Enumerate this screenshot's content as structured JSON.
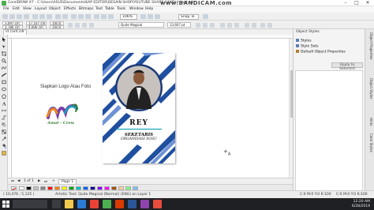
{
  "window": {
    "title": "CorelDRAW X7 - C:\\Users\\ASUS\\Documents\\KAP EDITOR\\DESAIN SHOP\\YOUTUBE SHARE SAKE\\id card.cdr",
    "watermark": "www.BANDICAM.com",
    "controls": [
      "–",
      "□",
      "✕"
    ]
  },
  "menu": [
    "File",
    "Edit",
    "View",
    "Layout",
    "Object",
    "Effects",
    "Bitmaps",
    "Text",
    "Table",
    "Tools",
    "Window",
    "Help"
  ],
  "toolbar": {
    "zoom_value": "106%",
    "snap_label": "Snap To"
  },
  "propbar": {
    "x": "3,097 cm",
    "y": "3,786 cm",
    "w": "17,107 cm",
    "h": "4,006 cm",
    "scale_w": "100,0",
    "scale_h": "100,0",
    "font_name": "Quite Magical",
    "font_size": "13,607 pt"
  },
  "document": {
    "tab_label": "id card.cdr"
  },
  "canvas": {
    "instruction": "Siapkan Logo Atau Foto",
    "logo_text": "Amal - Crew",
    "card_name": "REY",
    "card_line1": "SEKETARIS",
    "card_line2": "ORGANISASI SOSU"
  },
  "dock": {
    "title": "Object Styles",
    "items": [
      {
        "label": "Styles",
        "kind": "folder"
      },
      {
        "label": "Style Sets",
        "kind": "folder"
      },
      {
        "label": "Default Object Properties",
        "kind": "doc"
      }
    ],
    "apply_button": "Apply to Selected"
  },
  "sidetabs": [
    "Object Properties",
    "Object Styles",
    "Hints",
    "Color Styles"
  ],
  "pagenav": {
    "position": "1 of 1",
    "page_label": "Page 1"
  },
  "palette": [
    "#ffffff",
    "#000000",
    "#c0c0c0",
    "#808080",
    "#ff0000",
    "#ff8000",
    "#ffff00",
    "#00a000",
    "#00c0c0",
    "#0060ff",
    "#0000a0",
    "#8000ff",
    "#ff00ff",
    "#a05000",
    "#ffd0a0",
    "#80ff80",
    "#80c0ff"
  ],
  "status": {
    "coords": "( 10,476 ; 5,125 )",
    "object_info": "Artistic Text: Quite Magical (Normal) (ENG) on Layer 1",
    "fill_info": "C:0 M:0 Y:0 K:100",
    "outline_info": "C:0 M:0 Y:0 K:100"
  },
  "taskbar": {
    "time": "12:20 AM",
    "date": "6/28/2019"
  },
  "colors": {
    "card_blue": "#1f4fa0",
    "card_blue_light": "#6e92d6",
    "logo_orange": "#f08a1e",
    "logo_purple": "#7a3fa8",
    "logo_teal": "#18a0b8",
    "logo_green": "#2e7d32"
  }
}
